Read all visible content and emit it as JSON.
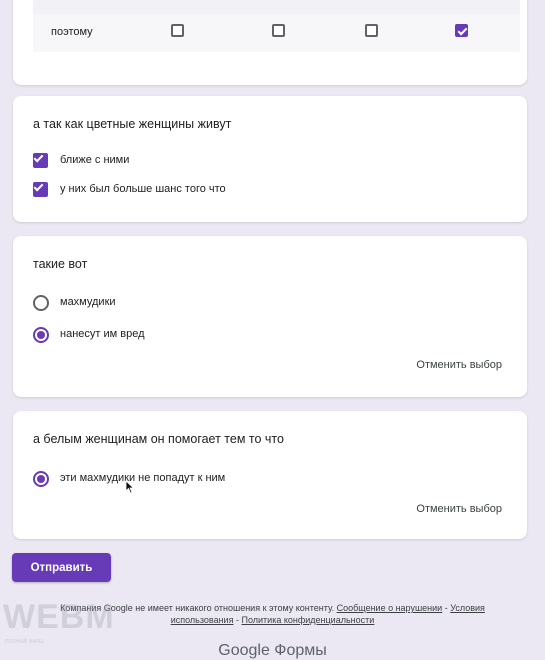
{
  "grid": {
    "row_label": "поэтому",
    "boxes": [
      {
        "checked": false
      },
      {
        "checked": false
      },
      {
        "checked": false
      },
      {
        "checked": true
      }
    ]
  },
  "q1": {
    "title": "а так как цветные женщины живут",
    "options": [
      {
        "label": "ближе с ними",
        "checked": true
      },
      {
        "label": "у них был больше шанс того что",
        "checked": true
      }
    ]
  },
  "q2": {
    "title": "такие вот",
    "options": [
      {
        "label": "махмудики",
        "selected": false
      },
      {
        "label": "нанесут им вред",
        "selected": true
      }
    ],
    "clear_label": "Отменить выбор"
  },
  "q3": {
    "title": "а белым женщинам он помогает тем то что",
    "options": [
      {
        "label": "эти махмудики не попадут к ним",
        "selected": true
      }
    ],
    "clear_label": "Отменить выбор"
  },
  "submit_label": "Отправить",
  "footer": {
    "text_prefix": "Компания Google не имеет никакого отношения к этому контенту.",
    "report_link": "Сообщение о нарушении",
    "separator": "-",
    "terms_link": "Условия использования",
    "privacy_link": "Политика конфиденциальности",
    "brand": "Google Формы"
  },
  "watermark": {
    "logo": "WEBM",
    "subtext": "ПОЛНЫЙ ФАРШ"
  },
  "colors": {
    "accent": "#673ab7",
    "background": "#ebe8f3"
  },
  "icons": [
    "checkbox-icon",
    "radio-icon",
    "cursor-icon"
  ]
}
